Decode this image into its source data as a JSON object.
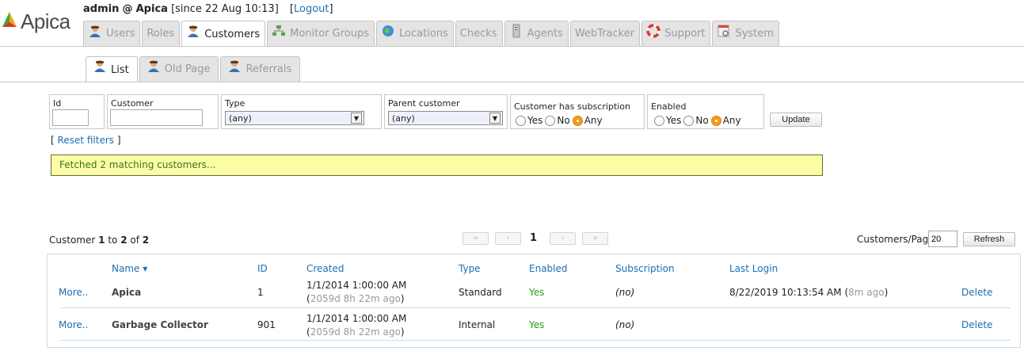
{
  "brand": {
    "logo_text": "Apica"
  },
  "header": {
    "user": "admin",
    "at": "@",
    "org": "Apica",
    "since": "[since 22 Aug 10:13]",
    "logout_open": "[",
    "logout_label": "Logout",
    "logout_close": "]"
  },
  "tabs": [
    {
      "label": "Users",
      "icon": "user-icon"
    },
    {
      "label": "Roles",
      "icon": ""
    },
    {
      "label": "Customers",
      "icon": "user-icon"
    },
    {
      "label": "Monitor Groups",
      "icon": "hierarchy-icon"
    },
    {
      "label": "Locations",
      "icon": "globe-icon"
    },
    {
      "label": "Checks",
      "icon": ""
    },
    {
      "label": "Agents",
      "icon": "server-icon"
    },
    {
      "label": "WebTracker",
      "icon": ""
    },
    {
      "label": "Support",
      "icon": "lifebuoy-icon"
    },
    {
      "label": "System",
      "icon": "gear-doc-icon"
    }
  ],
  "active_tab": "Customers",
  "subtabs": [
    {
      "label": "List"
    },
    {
      "label": "Old Page"
    },
    {
      "label": "Referrals"
    }
  ],
  "filters": {
    "id_label": "Id",
    "id_value": "",
    "customer_label": "Customer",
    "customer_value": "",
    "type_label": "Type",
    "type_value": "(any)",
    "parent_label": "Parent customer",
    "parent_value": "(any)",
    "subscription_label": "Customer has subscription",
    "subscription_options": [
      "Yes",
      "No",
      "Any"
    ],
    "subscription_selected": "Any",
    "enabled_label": "Enabled",
    "enabled_options": [
      "Yes",
      "No",
      "Any"
    ],
    "enabled_selected": "Any",
    "update_label": "Update"
  },
  "reset": {
    "open": "[",
    "label": "Reset filters",
    "close": "]"
  },
  "status_message": "Fetched 2 matching customers...",
  "pagination": {
    "count_prefix": "Customer",
    "from": "1",
    "to_word": "to",
    "to": "2",
    "of_word": "of",
    "total": "2",
    "first": "«",
    "prev": "‹",
    "page": "1",
    "next": "›",
    "last": "»",
    "per_page_label": "Customers/Page",
    "per_page_value": "20",
    "refresh_label": "Refresh"
  },
  "table": {
    "headers": [
      "Name",
      "ID",
      "Created",
      "Type",
      "Enabled",
      "Subscription",
      "Last Login"
    ],
    "sort_indicator": "▾",
    "rows": [
      {
        "more": "More..",
        "name": "Apica",
        "id": "1",
        "created": "1/1/2014 1:00:00 AM",
        "created_ago": "2059d 8h 22m ago",
        "type": "Standard",
        "enabled": "Yes",
        "subscription": "(no)",
        "last_login": "8/22/2019 10:13:54 AM",
        "last_login_ago": "8m ago",
        "delete": "Delete"
      },
      {
        "more": "More..",
        "name": "Garbage Collector",
        "id": "901",
        "created": "1/1/2014 1:00:00 AM",
        "created_ago": "2059d 8h 22m ago",
        "type": "Internal",
        "enabled": "Yes",
        "subscription": "(no)",
        "last_login": "",
        "last_login_ago": "",
        "delete": "Delete"
      }
    ]
  },
  "colors": {
    "link": "#1a6fb5",
    "status_bg": "#fafca6",
    "status_text": "#3a7a14",
    "radio_on": "#f39a1f",
    "enabled_yes": "#2a9d16"
  }
}
